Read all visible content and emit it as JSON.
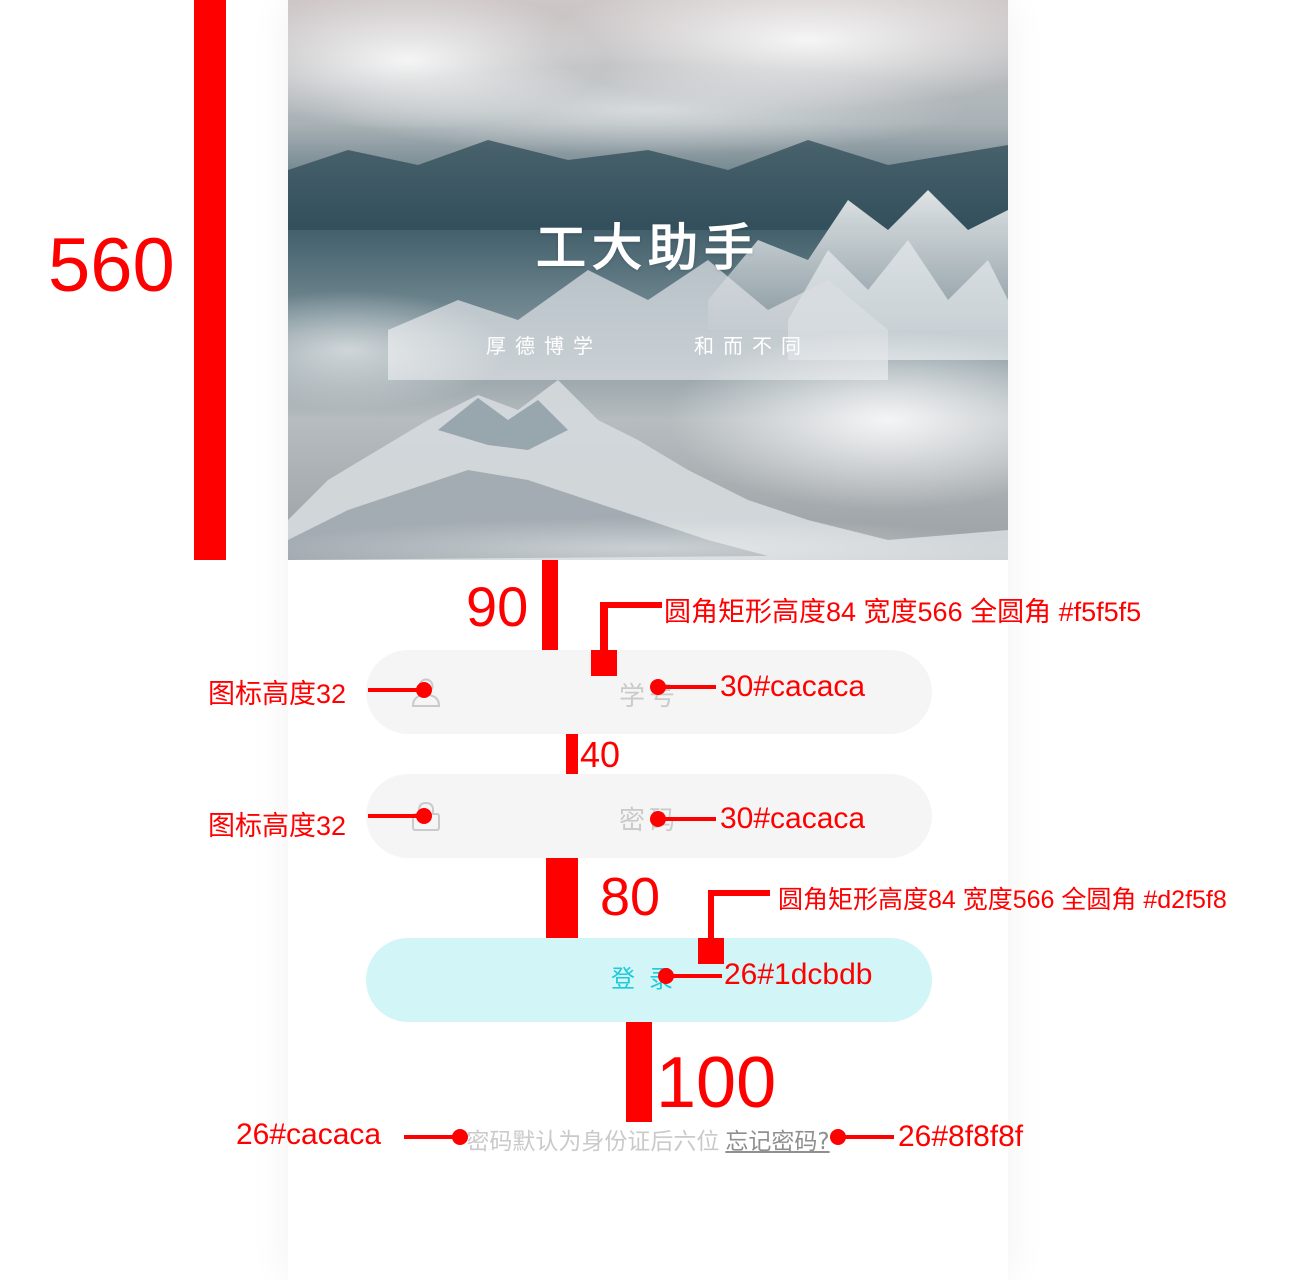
{
  "app": {
    "title": "工大助手",
    "motto_left": "厚德博学",
    "motto_right": "和而不同"
  },
  "form": {
    "username_placeholder": "学号",
    "password_placeholder": "密码",
    "login_label": "登录",
    "hint_text": "密码默认为身份证后六位",
    "forgot_label": "忘记密码?"
  },
  "icons": {
    "username": "user-icon",
    "password": "lock-icon"
  },
  "colors": {
    "field_bg": "#f5f5f5",
    "placeholder": "#cacaca",
    "button_bg": "#d2f5f8",
    "button_text": "#1dcbdb",
    "forgot_link": "#8f8f8f",
    "annotation": "#ff0000"
  },
  "annotations": {
    "header_height": "560",
    "gap_top": "90",
    "field_spec_1": "圆角矩形高度84 宽度566 全圆角 #f5f5f5",
    "icon_height_1": "图标高度32",
    "placeholder_spec_1": "30#cacaca",
    "gap_fields": "40",
    "icon_height_2": "图标高度32",
    "placeholder_spec_2": "30#cacaca",
    "gap_button": "80",
    "button_spec": "圆角矩形高度84 宽度566 全圆角 #d2f5f8",
    "button_text_spec": "26#1dcbdb",
    "gap_footer": "100",
    "hint_spec": "26#cacaca",
    "forgot_spec": "26#8f8f8f"
  }
}
